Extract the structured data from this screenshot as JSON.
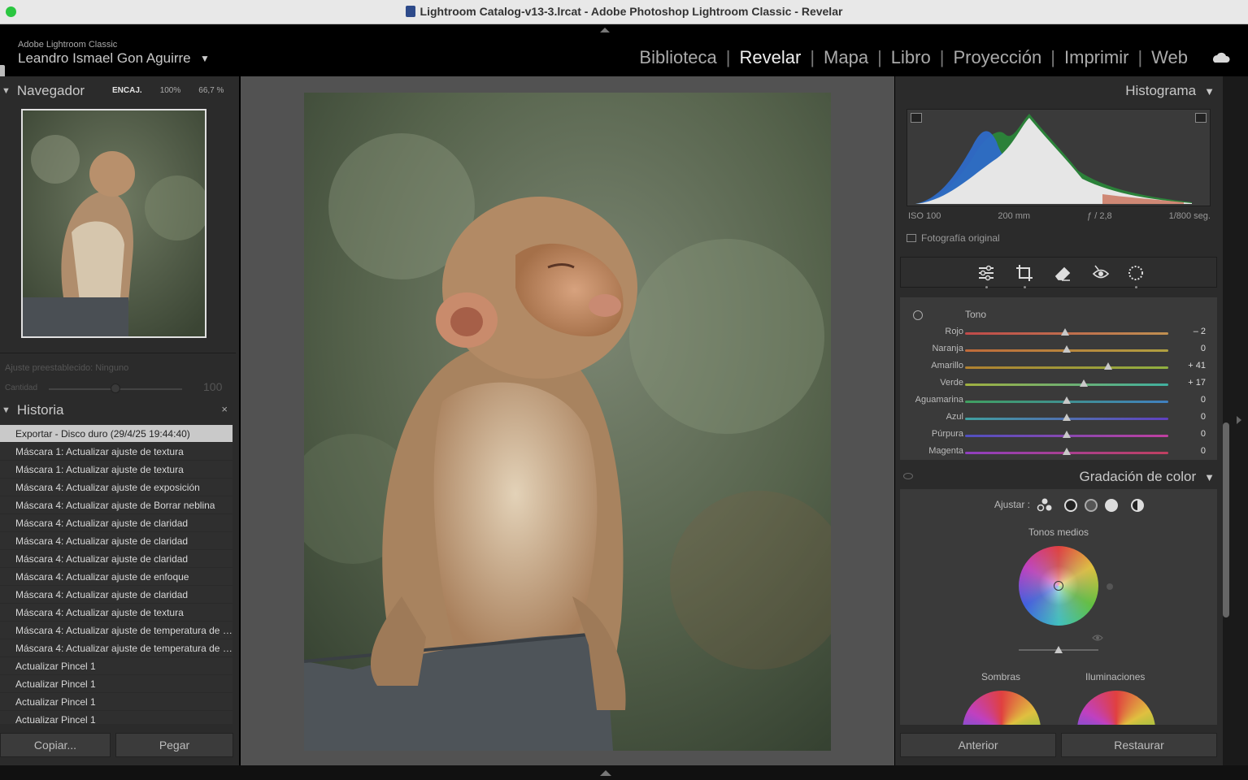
{
  "window": {
    "title": "Lightroom Catalog-v13-3.lrcat - Adobe Photoshop Lightroom Classic - Revelar"
  },
  "identity": {
    "app_small": "Adobe Lightroom Classic",
    "user_name": "Leandro Ismael Gon Aguirre",
    "caret": "▼"
  },
  "modules": [
    {
      "label": "Biblioteca",
      "active": false
    },
    {
      "label": "Revelar",
      "active": true
    },
    {
      "label": "Mapa",
      "active": false
    },
    {
      "label": "Libro",
      "active": false
    },
    {
      "label": "Proyección",
      "active": false
    },
    {
      "label": "Imprimir",
      "active": false
    },
    {
      "label": "Web",
      "active": false
    }
  ],
  "navigator": {
    "title": "Navegador",
    "fit": "ENCAJ.",
    "zoom_1": "100%",
    "zoom_2": "66,7 %"
  },
  "preset": {
    "label": "Ajuste preestablecido: Ninguno",
    "amount_label": "Cantidad",
    "amount_value": "100",
    "amount_fraction": 0.5
  },
  "history": {
    "title": "Historia",
    "close": "×",
    "items": [
      "Exportar - Disco duro (29/4/25 19:44:40)",
      "Máscara 1: Actualizar ajuste de textura",
      "Máscara 1: Actualizar ajuste de textura",
      "Máscara 4: Actualizar ajuste de exposición",
      "Máscara 4: Actualizar ajuste de Borrar neblina",
      "Máscara 4: Actualizar ajuste de claridad",
      "Máscara 4: Actualizar ajuste de claridad",
      "Máscara 4: Actualizar ajuste de claridad",
      "Máscara 4: Actualizar ajuste de enfoque",
      "Máscara 4: Actualizar ajuste de claridad",
      "Máscara 4: Actualizar ajuste de textura",
      "Máscara 4: Actualizar ajuste de temperatura de c...",
      "Máscara 4: Actualizar ajuste de temperatura de c...",
      "Actualizar Pincel 1",
      "Actualizar Pincel 1",
      "Actualizar Pincel 1",
      "Actualizar Pincel 1"
    ],
    "selected_index": 0
  },
  "left_buttons": {
    "copy": "Copiar...",
    "paste": "Pegar"
  },
  "histogram": {
    "title": "Histograma",
    "caret": "▼",
    "iso": "ISO 100",
    "focal": "200 mm",
    "aperture": "ƒ / 2,8",
    "shutter": "1/800 seg.",
    "original_photo": "Fotografía original"
  },
  "tools": [
    "sliders-icon",
    "crop-icon",
    "eraser-icon",
    "redeye-icon",
    "mask-icon"
  ],
  "tone": {
    "label": "Tono",
    "rows": [
      {
        "label": "Rojo",
        "value": "– 2",
        "amount": -2,
        "colors": [
          "#c04a4a",
          "#c09050"
        ]
      },
      {
        "label": "Naranja",
        "value": "0",
        "amount": 0,
        "colors": [
          "#c06a3a",
          "#b0a040"
        ]
      },
      {
        "label": "Amarillo",
        "value": "+ 41",
        "amount": 41,
        "colors": [
          "#b08030",
          "#90b040"
        ]
      },
      {
        "label": "Verde",
        "value": "+ 17",
        "amount": 17,
        "colors": [
          "#a0b040",
          "#40b0a0"
        ]
      },
      {
        "label": "Aguamarina",
        "value": "0",
        "amount": 0,
        "colors": [
          "#40a060",
          "#4080c0"
        ]
      },
      {
        "label": "Azul",
        "value": "0",
        "amount": 0,
        "colors": [
          "#40a0a0",
          "#6040c0"
        ]
      },
      {
        "label": "Púrpura",
        "value": "0",
        "amount": 0,
        "colors": [
          "#5050c0",
          "#c040a0"
        ]
      },
      {
        "label": "Magenta",
        "value": "0",
        "amount": 0,
        "colors": [
          "#9040c0",
          "#c04060"
        ]
      }
    ]
  },
  "color_grading": {
    "title": "Gradación de color",
    "caret": "▼",
    "adjust_label": "Ajustar :",
    "midtones": "Tonos medios",
    "shadows": "Sombras",
    "highlights": "Iluminaciones"
  },
  "right_buttons": {
    "previous": "Anterior",
    "reset": "Restaurar"
  },
  "colors": {
    "panel_bg": "#2b2b2b",
    "center_bg": "#525252",
    "selected_history": "#c9c9c9"
  }
}
